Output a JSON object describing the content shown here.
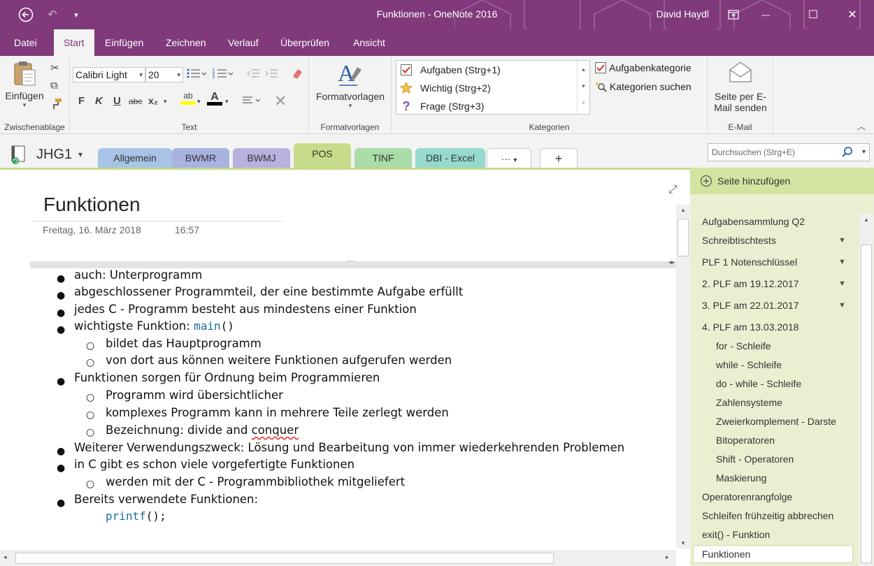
{
  "titlebar": {
    "title": "Funktionen  -  OneNote 2016",
    "user": "David Haydl",
    "back_glyph": "⬅",
    "undo_glyph": "↶",
    "qat_glyph": "▾",
    "restore_glyph": "⧉",
    "minimize_glyph": "—",
    "maximize_glyph": "☐",
    "close_glyph": "✕",
    "color": "#80397b"
  },
  "ribbon_tabs": [
    "Datei",
    "Start",
    "Einfügen",
    "Zeichnen",
    "Verlauf",
    "Überprüfen",
    "Ansicht"
  ],
  "ribbon": {
    "clipboard": {
      "paste_label": "Einfügen",
      "group_label": "Zwischenablage"
    },
    "text": {
      "font": "Calibri Light",
      "size": "20",
      "group_label": "Text",
      "bold": "F",
      "italic": "K",
      "underline": "U",
      "strike": "abc",
      "sub": "x₂",
      "highlight": "ab",
      "fontcolor": "A"
    },
    "styles": {
      "label": "Formatvorlagen",
      "group_label": "Formatvorlagen"
    },
    "tags": {
      "items": [
        {
          "label": "Aufgaben (Strg+1)",
          "icon": "checkbox-icon"
        },
        {
          "label": "Wichtig (Strg+2)",
          "icon": "star-icon"
        },
        {
          "label": "Frage (Strg+3)",
          "icon": "question-icon"
        }
      ],
      "tag_category": "Aufgabenkategorie",
      "find_tags": "Kategorien suchen",
      "group_label": "Kategorien"
    },
    "email": {
      "label_1": "Seite per E-",
      "label_2": "Mail senden",
      "group_label": "E-Mail"
    }
  },
  "notebook": {
    "name": "JHG1",
    "sections": [
      {
        "label": "Allgemein",
        "color": "#a8c3e6"
      },
      {
        "label": "BWMR",
        "color": "#a8b3e2"
      },
      {
        "label": "BWMJ",
        "color": "#b9b0e0"
      },
      {
        "label": "POS",
        "color": "#c7dc8b"
      },
      {
        "label": "TINF",
        "color": "#a9dca6"
      },
      {
        "label": "DBI - Excel",
        "color": "#96d9cf"
      }
    ],
    "more_label": "···",
    "add_label": "+",
    "search_placeholder": "Durchsuchen (Strg+E)"
  },
  "page": {
    "title": "Funktionen",
    "date": "Freitag, 16. März 2018",
    "time": "16:57",
    "dots": "····",
    "lines": {
      "l1": "auch: Unterprogramm",
      "l2": "abgeschlossener Programmteil, der eine bestimmte Aufgabe erfüllt",
      "l3": "jedes C - Programm besteht aus mindestens einer Funktion",
      "l4": "wichtigste Funktion: ",
      "l4_code": "main",
      "l4_paren": "()",
      "l5": "bildet das Hauptprogramm",
      "l6": "von dort aus können weitere Funktionen aufgerufen werden",
      "l7": "Funktionen sorgen für Ordnung beim Programmieren",
      "l8": "Programm wird übersichtlicher",
      "l9": "komplexes Programm kann in mehrere Teile zerlegt werden",
      "l10a": "Bezeichnung: divide and ",
      "l10b": "conquer",
      "l11": "Weiterer Verwendungszweck: Lösung und Bearbeitung von immer wiederkehrenden Problemen",
      "l12": "in C gibt es schon viele vorgefertigte Funktionen",
      "l13": "werden mit der C - Programmbibliothek mitgeliefert",
      "l14": "Bereits verwendete Funktionen:",
      "l15_code": "printf",
      "l15_rest": "();"
    }
  },
  "page_list": {
    "add_label": "Seite hinzufügen",
    "items": [
      "Aufgabensammlung Q2",
      "Schreibtischtests",
      "PLF 1 Notenschlüssel",
      "2. PLF am 19.12.2017",
      "3. PLF am 22.01.2017",
      "4. PLF am 13.03.2018",
      "for - Schleife",
      "while - Schleife",
      "do - while - Schleife",
      "Zahlensysteme",
      "Zweierkomplement - Darste",
      "Bitoperatoren",
      "Shift - Operatoren",
      "Maskierung",
      "Operatorenrangfolge",
      "Schleifen frühzeitig abbrechen",
      "exit() - Funktion",
      "Funktionen"
    ]
  }
}
